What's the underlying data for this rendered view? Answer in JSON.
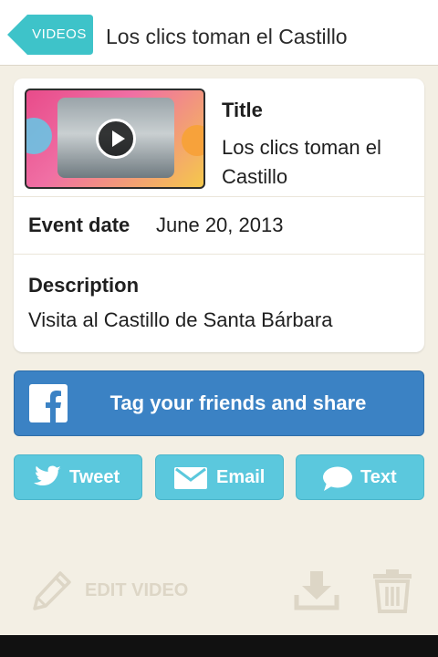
{
  "nav": {
    "back_label": "VIDEOS",
    "title": "Los clics toman el Castillo"
  },
  "card": {
    "title_label": "Title",
    "title_value": "Los clics toman el Castillo",
    "date_label": "Event date",
    "date_value": "June 20, 2013",
    "description_label": "Description",
    "description_value": "Visita al Castillo de Santa Bárbara"
  },
  "facebook": {
    "label": "Tag your friends and share",
    "icon": "facebook-icon"
  },
  "share": [
    {
      "label": "Tweet",
      "icon": "twitter-bird-icon"
    },
    {
      "label": "Email",
      "icon": "envelope-icon"
    },
    {
      "label": "Text",
      "icon": "speech-bubble-icon"
    }
  ],
  "footer": {
    "edit_label": "EDIT VIDEO",
    "edit_icon": "pencil-icon",
    "download_icon": "download-icon",
    "delete_icon": "trash-icon"
  },
  "colors": {
    "accent_teal": "#3ec3c9",
    "facebook_blue": "#3b82c4",
    "share_cyan": "#5bc8dd",
    "background": "#f3efe4"
  }
}
